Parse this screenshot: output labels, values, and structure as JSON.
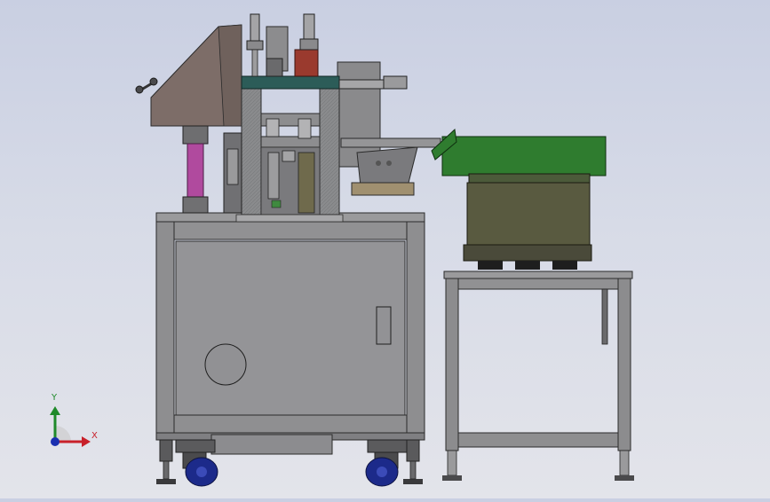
{
  "view": {
    "background_top": "#c9cfe2",
    "background_bottom": "#e3e4ea"
  },
  "triad": {
    "x_label": "X",
    "y_label": "Y",
    "x_color": "#c8202a",
    "y_color": "#1f8a2a",
    "z_color": "#1a2fb0"
  },
  "colors": {
    "frame_metal": "#8b8b8d",
    "panel_metal": "#939396",
    "dark_metal": "#6c6d70",
    "hopper": "#7d6d68",
    "guide_tube": "#b04a9e",
    "bowl_green": "#2f7c2f",
    "bowl_body": "#595a40",
    "drive_red": "#9a3a2e",
    "plate_teal": "#2c5c58",
    "caster_blue": "#1c2a8a"
  }
}
